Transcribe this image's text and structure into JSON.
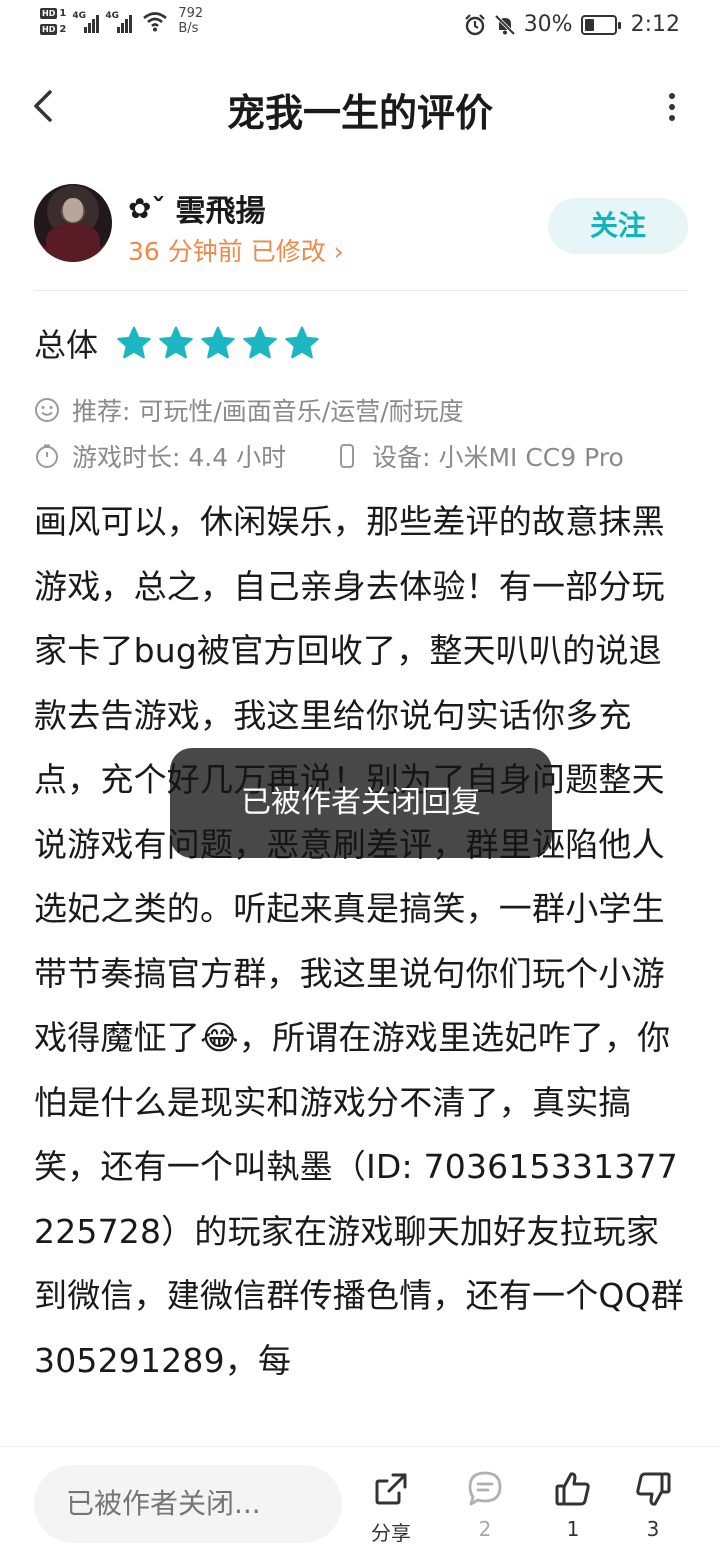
{
  "status_bar": {
    "hd1": "HD",
    "hd1_num": "1",
    "hd2": "HD",
    "hd2_num": "2",
    "sig1": "4G",
    "sig2": "4G",
    "net_speed_value": "792",
    "net_speed_unit": "B/s",
    "battery": "30%",
    "time": "2:12"
  },
  "header": {
    "title": "宠我一生的评价"
  },
  "author": {
    "name_prefix": "✿ˇ",
    "name": "雲飛揚",
    "meta": "36 分钟前 已修改 ›",
    "follow_label": "关注"
  },
  "rating": {
    "label": "总体",
    "stars": 5,
    "color": "#1db6c3"
  },
  "info": {
    "recommend": "推荐:  可玩性/画面音乐/运营/耐玩度",
    "playtime": "游戏时长:  4.4 小时",
    "device": "设备:  小米MI CC9 Pro"
  },
  "review": {
    "part1": "画风可以，休闲娱乐，那些差评的故意抹黑游戏，总之，自己亲身去体验！有一部分玩家卡了bug被官方回收了，整天叭叭的说退款去告游戏，我这里给你说句实话你多充点，充个好几万再说！别为了自身问题整天说游戏有问题，恶意刷差评，群里诬陷他人选妃之类的。听起来真是搞笑，一群小学生带节奏搞官方群，我这里说句你们玩个小游戏得魔怔了",
    "emoji": "😂",
    "part2": "，所谓在游戏里选妃咋了，你怕是什么是现实和游戏分不清了，真实搞笑，还有一个叫執墨（ID: 7036153313772257​28）的玩家在游戏聊天加好友拉玩家到微信，建微信群传播色情，还有一个QQ群305291289，每"
  },
  "toast": {
    "text": "已被作者关闭回复"
  },
  "bottom_bar": {
    "input_placeholder": "已被作者关闭...",
    "share_label": "分享",
    "comment_count": "2",
    "like_count": "1",
    "dislike_count": "3"
  }
}
